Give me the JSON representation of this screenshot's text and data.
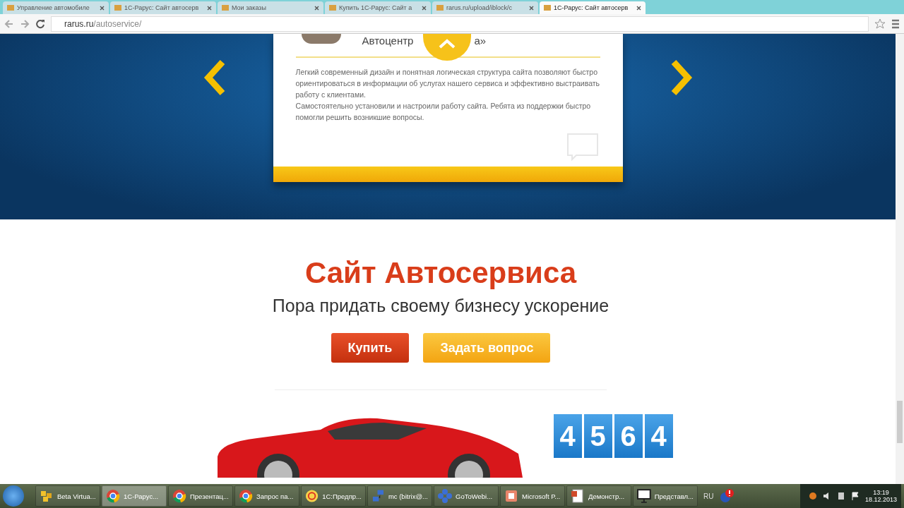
{
  "browser": {
    "tabs": [
      {
        "title": "Управление автомобиле",
        "selected": false
      },
      {
        "title": "1С-Рарус: Сайт автосерв",
        "selected": false
      },
      {
        "title": "Мои заказы",
        "selected": false
      },
      {
        "title": "Купить 1С-Рарус: Сайт а",
        "selected": false
      },
      {
        "title": "rarus.ru/upload/iblock/c",
        "selected": false
      },
      {
        "title": "1С-Рарус: Сайт автосерв",
        "selected": true
      }
    ],
    "url_host": "rarus.ru",
    "url_path": "/autoservice/"
  },
  "testimonial": {
    "name_start": "Автоцентр",
    "name_end": "а»",
    "text": "Легкий современный дизайн и понятная логическая структура сайта позволяют быстро ориентироваться в информации об услугах нашего сервиса и эффективно выстраивать работу с клиентами.",
    "text_2": "Самостоятельно установили и настроили работу сайта. Ребята из поддержки быстро помогли решить возникшие вопросы."
  },
  "hero": {
    "title": "Сайт Автосервиса",
    "subtitle": "Пора придать своему бизнесу ускорение",
    "buttons": [
      {
        "label": "Купить",
        "kind": "primary"
      },
      {
        "label": "Задать вопрос",
        "kind": "secondary"
      }
    ],
    "counter": [
      "4",
      "5",
      "6",
      "4"
    ]
  },
  "taskbar": {
    "items": [
      {
        "label": "Beta Virtua...",
        "kind": "folder",
        "selected": false
      },
      {
        "label": "1С-Рарус...",
        "kind": "chrome",
        "selected": true
      },
      {
        "label": "Презентац...",
        "kind": "chrome",
        "selected": false
      },
      {
        "label": "Запрос па...",
        "kind": "chrome",
        "selected": false
      },
      {
        "label": "1С:Предпр...",
        "kind": "onec",
        "selected": false
      },
      {
        "label": "mc (bitrix@...",
        "kind": "network",
        "selected": false
      },
      {
        "label": "GoToWebi...",
        "kind": "flower",
        "selected": false
      },
      {
        "label": "Microsoft P...",
        "kind": "ppt",
        "selected": false
      },
      {
        "label": "Демонстр...",
        "kind": "doc",
        "selected": false
      },
      {
        "label": "Представл...",
        "kind": "screen",
        "selected": false
      }
    ],
    "language": "RU",
    "time": "13:19",
    "date": "18.12.2013"
  }
}
